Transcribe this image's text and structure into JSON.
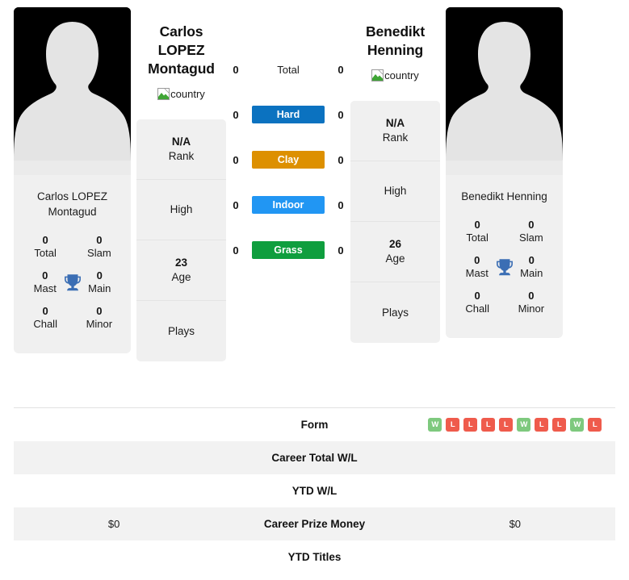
{
  "players": {
    "left": {
      "name": "Carlos LOPEZ Montagud",
      "name_line1": "Carlos LOPEZ",
      "name_line2": "Montagud",
      "card_name_line1": "Carlos LOPEZ",
      "card_name_line2": "Montagud",
      "flag_alt": "country",
      "titles": [
        {
          "value": "0",
          "label": "Total"
        },
        {
          "value": "0",
          "label": "Slam"
        },
        {
          "value": "0",
          "label": "Mast"
        },
        {
          "value": "0",
          "label": "Main"
        },
        {
          "value": "0",
          "label": "Chall"
        },
        {
          "value": "0",
          "label": "Minor"
        }
      ],
      "stack": [
        {
          "value": "N/A",
          "label": "Rank"
        },
        {
          "value": "",
          "label": "High"
        },
        {
          "value": "23",
          "label": "Age"
        },
        {
          "value": "",
          "label": "Plays"
        }
      ],
      "prize_money": "$0"
    },
    "right": {
      "name": "Benedikt Henning",
      "name_line1": "Benedikt",
      "name_line2": "Henning",
      "card_name_line1": "Benedikt Henning",
      "card_name_line2": "",
      "flag_alt": "country",
      "titles": [
        {
          "value": "0",
          "label": "Total"
        },
        {
          "value": "0",
          "label": "Slam"
        },
        {
          "value": "0",
          "label": "Mast"
        },
        {
          "value": "0",
          "label": "Main"
        },
        {
          "value": "0",
          "label": "Chall"
        },
        {
          "value": "0",
          "label": "Minor"
        }
      ],
      "stack": [
        {
          "value": "N/A",
          "label": "Rank"
        },
        {
          "value": "",
          "label": "High"
        },
        {
          "value": "26",
          "label": "Age"
        },
        {
          "value": "",
          "label": "Plays"
        }
      ],
      "prize_money": "$0"
    }
  },
  "surfaces": [
    {
      "label": "Total",
      "left": "0",
      "right": "0",
      "color": "transparent"
    },
    {
      "label": "Hard",
      "left": "0",
      "right": "0",
      "color": "#0b72c0"
    },
    {
      "label": "Clay",
      "left": "0",
      "right": "0",
      "color": "#dd9000"
    },
    {
      "label": "Indoor",
      "left": "0",
      "right": "0",
      "color": "#2196f3"
    },
    {
      "label": "Grass",
      "left": "0",
      "right": "0",
      "color": "#0f9e3e"
    }
  ],
  "table": {
    "rows": [
      {
        "label": "Form",
        "left": "",
        "right": ""
      },
      {
        "label": "Career Total W/L",
        "left": "",
        "right": ""
      },
      {
        "label": "YTD W/L",
        "left": "",
        "right": ""
      },
      {
        "label": "Career Prize Money",
        "left": "$0",
        "right": "$0"
      },
      {
        "label": "YTD Titles",
        "left": "",
        "right": ""
      }
    ]
  },
  "form": {
    "results": [
      "W",
      "L",
      "L",
      "L",
      "L",
      "W",
      "L",
      "L",
      "W",
      "L"
    ],
    "win_color": "#7ec97e",
    "loss_color": "#ef5b4c"
  },
  "theme": {
    "trophy_color": "#3b6eb4",
    "card_bg": "#f0f0f0",
    "row_alt_bg": "#f2f2f2"
  }
}
